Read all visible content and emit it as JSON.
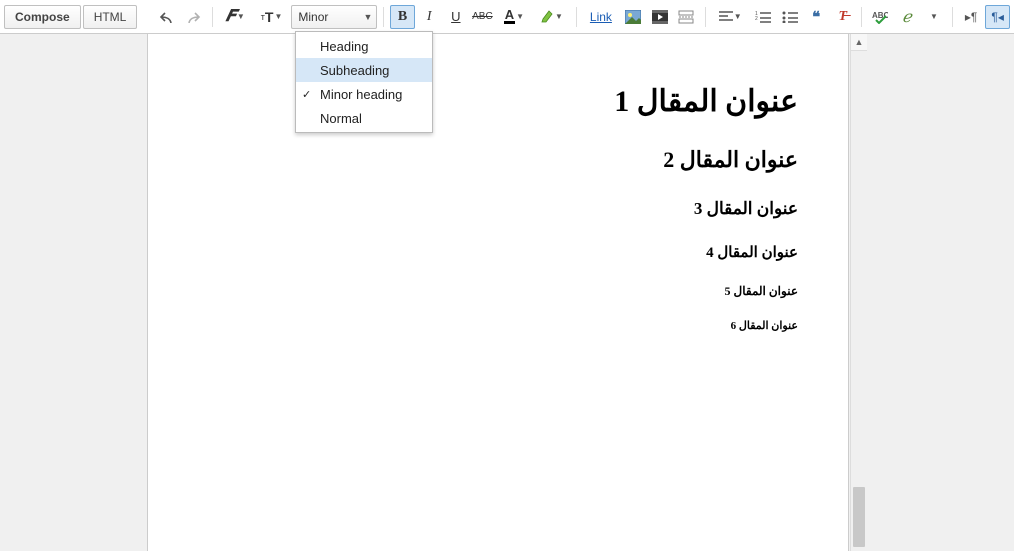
{
  "toolbar": {
    "compose_label": "Compose",
    "html_label": "HTML",
    "font_family_btn": "F",
    "font_size_btn": "тT",
    "heading_select_value": "Minor",
    "bold_label": "B",
    "italic_label": "I",
    "underline_label": "U",
    "strike_label": "ABC",
    "textcolor_label": "A",
    "link_label": "Link",
    "quote_label": "❝",
    "removefmt_label": "Tx",
    "ltr_label": "¶‹",
    "rtl_label": "›¶"
  },
  "heading_menu": {
    "items": [
      {
        "label": "Heading",
        "checked": false,
        "highlight": false
      },
      {
        "label": "Subheading",
        "checked": false,
        "highlight": true
      },
      {
        "label": "Minor heading",
        "checked": true,
        "highlight": false
      },
      {
        "label": "Normal",
        "checked": false,
        "highlight": false
      }
    ]
  },
  "document": {
    "lines": [
      {
        "cls": "h1",
        "text": "عنوان المقال 1"
      },
      {
        "cls": "h2",
        "text": "عنوان المقال 2"
      },
      {
        "cls": "h3",
        "text": "عنوان المقال 3"
      },
      {
        "cls": "h4",
        "text": "عنوان المقال 4"
      },
      {
        "cls": "h5",
        "text": "عنوان المقال 5"
      },
      {
        "cls": "h6",
        "text": "عنوان المقال 6"
      }
    ]
  }
}
